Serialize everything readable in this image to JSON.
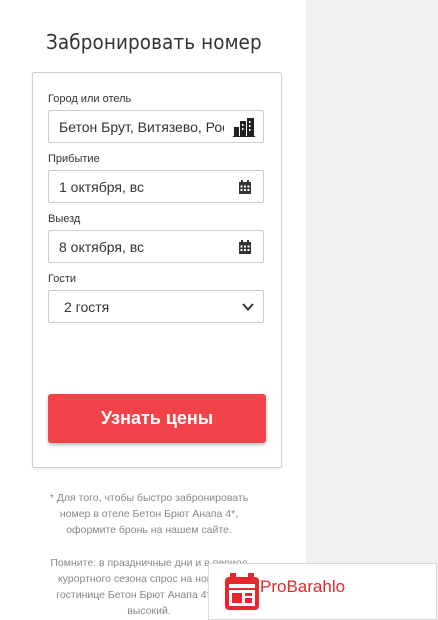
{
  "booking": {
    "title": "Забронировать номер",
    "city_label": "Город или отель",
    "city_value": "Бетон Брут, Витязево, Россия",
    "arrival_label": "Прибытие",
    "arrival_value": "1 октября, вс",
    "departure_label": "Выезд",
    "departure_value": "8 октября, вс",
    "guests_label": "Гости",
    "guests_value": "2 гостя",
    "submit_label": "Узнать цены"
  },
  "notes": {
    "note1": "* Для того, чтобы быстро забронировать номер в отеле Бетон Брют Анапа 4*, оформите бронь на нашем сайте.",
    "note2": "Помните: в праздничные дни и в период курортного сезона спрос на номера в гостинице Бетон Брют Анапа 4* очень высокий."
  },
  "watermark": {
    "text": "ProBarahlo"
  },
  "colors": {
    "accent": "#f2434b",
    "watermark_red": "#e8262e"
  }
}
